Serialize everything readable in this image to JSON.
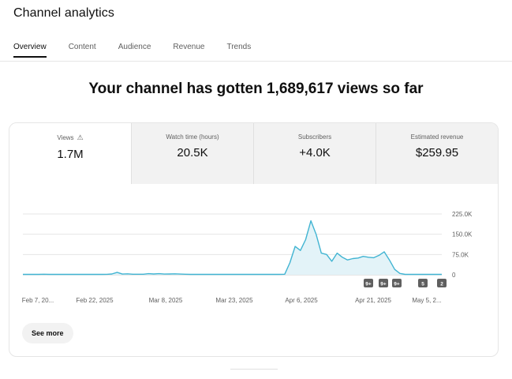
{
  "page": {
    "title": "Channel analytics"
  },
  "tabs": [
    {
      "label": "Overview",
      "active": true
    },
    {
      "label": "Content",
      "active": false
    },
    {
      "label": "Audience",
      "active": false
    },
    {
      "label": "Revenue",
      "active": false
    },
    {
      "label": "Trends",
      "active": false
    }
  ],
  "headline": "Your channel has gotten 1,689,617 views so far",
  "metrics": [
    {
      "label": "Views",
      "value": "1.7M",
      "icon": "warning-icon",
      "selected": true
    },
    {
      "label": "Watch time (hours)",
      "value": "20.5K"
    },
    {
      "label": "Subscribers",
      "value": "+4.0K"
    },
    {
      "label": "Estimated revenue",
      "value": "$259.95"
    }
  ],
  "see_more_label": "See more",
  "colors": {
    "line": "#41b4d2",
    "fill": "#e3f3f8",
    "grid": "#e5e5e5",
    "badge": "#5f5f5f"
  },
  "chart_data": {
    "type": "area",
    "x_tick_labels": [
      "Feb 7, 20...",
      "Feb 22, 2025",
      "Mar 8, 2025",
      "Mar 23, 2025",
      "Apr 6, 2025",
      "Apr 21, 2025",
      "May 5, 2..."
    ],
    "y_tick_labels": [
      "225.0K",
      "150.0K",
      "75.0K",
      "0"
    ],
    "ylim": [
      0,
      225000
    ],
    "grid": true,
    "series": [
      {
        "values": [
          1500,
          1500,
          1800,
          1500,
          2000,
          1500,
          1500,
          1800,
          1500,
          1500,
          1500,
          1500,
          1500,
          1500,
          1500,
          1500,
          1800,
          3000,
          9000,
          2500,
          3500,
          2000,
          2000,
          2000,
          4000,
          3000,
          4000,
          2500,
          3000,
          3500,
          2500,
          2000,
          1500,
          1500,
          1500,
          1500,
          1500,
          1500,
          1500,
          1500,
          1500,
          1500,
          1500,
          1500,
          1500,
          1500,
          1500,
          1500,
          1500,
          1500,
          2000,
          45000,
          105000,
          90000,
          130000,
          200000,
          150000,
          80000,
          75000,
          50000,
          80000,
          65000,
          55000,
          60000,
          62000,
          68000,
          65000,
          63000,
          72000,
          85000,
          55000,
          20000,
          5000,
          1500,
          1500,
          1500,
          1500,
          1500,
          1500,
          1500,
          1500
        ]
      }
    ],
    "annotations": [
      "9+",
      "9+",
      "9+",
      "5",
      "2"
    ]
  }
}
